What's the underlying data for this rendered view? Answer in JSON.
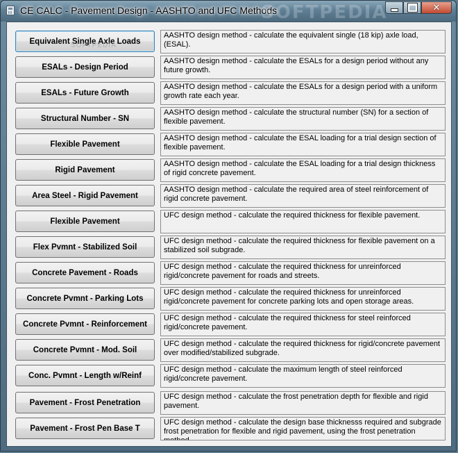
{
  "window": {
    "title": "CE CALC - Pavement Design - AASHTO and UFC Methods",
    "watermark": "SOFTPEDIA",
    "close_glyph": "✕"
  },
  "rows": [
    {
      "button": "Equivalent Single Axle Loads",
      "description": "AASHTO design method - calculate the equivalent single (18 kip) axle load, (ESAL).",
      "overlay": "SOFTPEDIA"
    },
    {
      "button": "ESALs - Design Period",
      "description": "AASHTO design method - calculate the ESALs for a design period without any future growth."
    },
    {
      "button": "ESALs - Future Growth",
      "description": "AASHTO design method - calculate the ESALs for a design period with a uniform growth rate each year."
    },
    {
      "button": "Structural Number - SN",
      "description": "AASHTO design method - calculate the structural number (SN) for a section of flexible pavement."
    },
    {
      "button": "Flexible Pavement",
      "description": "AASHTO design method - calculate the ESAL loading for a trial design section of flexible pavement."
    },
    {
      "button": "Rigid Pavement",
      "description": "AASHTO design method - calculate the ESAL loading for a trial design thickness of rigid concrete pavement."
    },
    {
      "button": "Area Steel - Rigid Pavement",
      "description": "AASHTO design method - calculate the required area of steel reinforcement of rigid concrete pavement."
    },
    {
      "button": "Flexible Pavement",
      "description": "UFC design method - calculate the required thickness for flexible pavement."
    },
    {
      "button": "Flex Pvmnt - Stabilized Soil",
      "description": "UFC design method - calculate the required thickness for flexible pavement on a stabilized soil subgrade."
    },
    {
      "button": "Concrete Pavement - Roads",
      "description": "UFC design method - calculate the required thickness for unreinforced rigid/concrete pavement for roads and streets."
    },
    {
      "button": "Concrete Pvmnt - Parking Lots",
      "description": "UFC design method - calculate the required thickness for unreinforced rigid/concrete pavement for concrete parking lots and open storage areas."
    },
    {
      "button": "Concrete Pvmnt - Reinforcement",
      "description": "UFC design method - calculate the required thickness for steel reinforced rigid/concrete pavement."
    },
    {
      "button": "Concrete Pvmnt - Mod. Soil",
      "description": "UFC design method - calculate the required thickness for rigid/concrete pavement over modified/stabilized subgrade."
    },
    {
      "button": "Conc. Pvmnt - Length w/Reinf",
      "description": "UFC design method - calculate the maximum length of steel reinforced rigid/concrete pavement."
    },
    {
      "button": "Pavement - Frost Penetration",
      "description": "UFC design method - calculate the frost penetration depth for flexible and rigid pavement."
    },
    {
      "button": "Pavement - Frost Pen Base T",
      "description": "UFC design method - calculate the design base thicknesss required and subgrade frost penetration for flexible and rigid pavement, using the frost penetration method."
    }
  ]
}
